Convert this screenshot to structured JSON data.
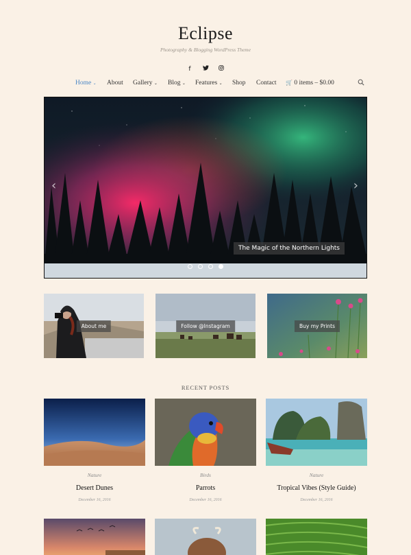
{
  "site": {
    "title": "Eclipse",
    "tagline": "Photography & Blogging WordPress Theme"
  },
  "social": [
    {
      "icon": "facebook-icon",
      "glyph": "f"
    },
    {
      "icon": "twitter-icon",
      "glyph": "🐦"
    },
    {
      "icon": "instagram-icon",
      "glyph": "◎"
    }
  ],
  "nav": {
    "home": "Home",
    "about": "About",
    "gallery": "Gallery",
    "blog": "Blog",
    "features": "Features",
    "shop": "Shop",
    "contact": "Contact",
    "cart": "0 items – $0.00",
    "active_color": "#4a86c5"
  },
  "slider": {
    "caption": "The Magic of the Northern Lights",
    "slide_count": 4,
    "active_slide": 4
  },
  "promos": [
    {
      "label": "About me"
    },
    {
      "label": "Follow @Instagram"
    },
    {
      "label": "Buy my Prints"
    }
  ],
  "recent": {
    "heading": "RECENT POSTS",
    "posts": [
      {
        "category": "Nature",
        "title": "Desert Dunes",
        "date": "December 16, 2016"
      },
      {
        "category": "Birds",
        "title": "Parrots",
        "date": "December 16, 2016"
      },
      {
        "category": "Nature",
        "title": "Tropical Vibes (Style Guide)",
        "date": "December 16, 2016"
      }
    ]
  },
  "colors": {
    "background": "#faf1e6",
    "accent": "#4a86c5"
  }
}
